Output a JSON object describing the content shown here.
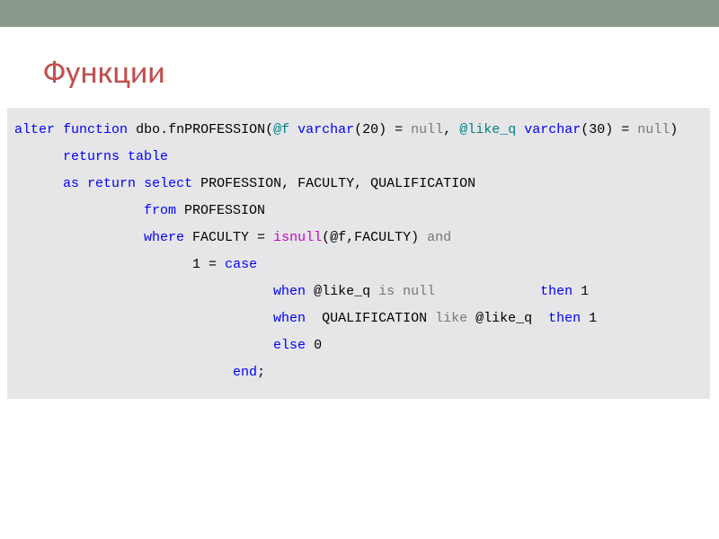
{
  "slide": {
    "title": "Функции"
  },
  "code": {
    "tokens": {
      "alter": "alter",
      "function": "function",
      "fname": "dbo.fnPROFESSION",
      "lp1": "(",
      "p_f": "@f",
      "varchar1": "varchar",
      "vc1_args": "(20) = ",
      "null1": "null",
      "comma1": ", ",
      "p_likeq": "@like_q",
      "varchar2": "varchar",
      "vc2_args": "(30) = ",
      "null2": "null",
      "rp1": ")",
      "returns": "returns",
      "table": "table",
      "as": "as",
      "return": "return",
      "select": "select",
      "cols": " PROFESSION, FACULTY, QUALIFICATION",
      "from": "from",
      "tbl": " PROFESSION",
      "where": "where",
      "faculty_eq": " FACULTY = ",
      "isnull": "isnull",
      "isnull_args": "(@f,FACULTY) ",
      "and": "and",
      "one_eq": "1 = ",
      "case": "case",
      "when1": "when",
      "when1_cond_a": " @like_q ",
      "is": "is",
      "null3": "null",
      "pad1": "             ",
      "then1": "then",
      "then1_val": " 1",
      "when2": "when",
      "when2_cond_a": "  QUALIFICATION ",
      "like": "like",
      "when2_cond_b": " @like_q  ",
      "then2": "then",
      "then2_val": " 1",
      "else": "else",
      "else_val": " 0",
      "end": "end",
      "semi": ";"
    }
  }
}
